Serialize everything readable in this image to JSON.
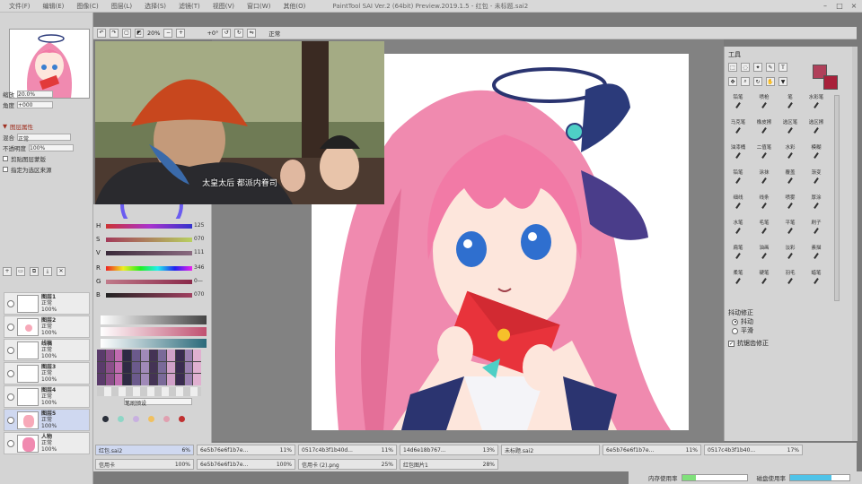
{
  "titlebar": {
    "menus": [
      "文件(F)",
      "编辑(E)",
      "图像(C)",
      "图层(L)",
      "选择(S)",
      "滤镜(T)",
      "视图(V)",
      "窗口(W)",
      "其他(O)"
    ],
    "title": "PaintTool SAI Ver.2 (64bit) Preview.2019.1.5 - 红包 - 未标题.sai2"
  },
  "toolbar": {
    "zoom": "20%",
    "angle": "+0°",
    "mode": "正常"
  },
  "navigator": {
    "zoom_label": "缩放",
    "zoom_value": "20.0%",
    "angle_label": "角度",
    "angle_value": "+000"
  },
  "layer_props": {
    "section": "图层属性",
    "blend_label": "混合",
    "blend_value": "正常",
    "opacity_label": "不透明度",
    "opacity_value": "100%",
    "clip_label": "剪贴图层蒙版",
    "ref_label": "指定为选区来源"
  },
  "layers": [
    {
      "name": "图层1",
      "mode": "正常",
      "opacity": "100%"
    },
    {
      "name": "图层2",
      "mode": "正常",
      "opacity": "100%"
    },
    {
      "name": "线稿",
      "mode": "正常",
      "opacity": "100%"
    },
    {
      "name": "图层3",
      "mode": "正常",
      "opacity": "100%"
    },
    {
      "name": "图层4",
      "mode": "正常",
      "opacity": "100%"
    },
    {
      "name": "图层5",
      "mode": "正常",
      "opacity": "100%"
    },
    {
      "name": "人物",
      "mode": "正常",
      "opacity": "100%"
    }
  ],
  "color": {
    "hsv": [
      {
        "label": "H",
        "value": "125"
      },
      {
        "label": "S",
        "value": "070"
      },
      {
        "label": "V",
        "value": "111"
      }
    ],
    "rgb": [
      {
        "label": "R",
        "value": "346"
      },
      {
        "label": "G",
        "value": "0—"
      },
      {
        "label": "B",
        "value": "070"
      }
    ],
    "swatches": [
      "#5a3b6b",
      "#8b4f8a",
      "#c06bb0",
      "#2e2a44",
      "#6b5a8c",
      "#a08ab8",
      "#443355",
      "#7a6a99",
      "#d0a0c8",
      "#3a2b50",
      "#9a7fb0",
      "#e0b0d0"
    ],
    "dots": [
      "#2a2f3a",
      "#8ed6c6",
      "#c8b0e0",
      "#f0c060",
      "#e0a0b0",
      "#c03030"
    ],
    "brush_preset_label": "笔刷预设"
  },
  "video": {
    "subtitle": "太皇太后 都派内眷司"
  },
  "right_panel": {
    "title": "工具",
    "primary_color": "#b0405a",
    "secondary_color": "#a8203a",
    "brush_rows": [
      [
        "铅笔",
        "喷枪",
        "笔",
        "水彩笔"
      ],
      [
        "马克笔",
        "橡皮擦",
        "选区笔",
        "选区擦"
      ],
      [
        "油漆桶",
        "二值笔",
        "水彩",
        "模糊"
      ],
      [
        "铅笔",
        "涂抹",
        "覆盖",
        "渐变"
      ],
      [
        "细线",
        "线条",
        "喷雾",
        "厚涂"
      ],
      [
        "水笔",
        "毛笔",
        "平笔",
        "刷子"
      ],
      [
        "扁笔",
        "油画",
        "淡彩",
        "素描"
      ],
      [
        "柔笔",
        "硬笔",
        "羽毛",
        "蜡笔"
      ]
    ],
    "stabilizer_label": "抖动修正",
    "opt1": "抖动",
    "opt2": "平滑",
    "check_label": "抗锯齿修正"
  },
  "doc_tabs": [
    [
      "红包.sai2",
      "6%"
    ],
    [
      "6e5b76e6f1b7e...",
      "11%"
    ],
    [
      "0517c4b3f1b40d...",
      "11%"
    ],
    [
      "14d6e18b767...",
      "13%"
    ],
    [
      "未标题.sai2",
      ""
    ],
    [
      "6e5b76e6f1b7e...",
      "11%"
    ],
    [
      "0517c4b3f1b40...",
      "17%"
    ],
    [
      "信用卡",
      "100%"
    ],
    [
      "6e5b76e6f1b7e...",
      "100%"
    ],
    [
      "信用卡 (2).png",
      "25%"
    ],
    [
      "红包图片1",
      "28%"
    ]
  ],
  "status": {
    "memory_label": "内存使用率",
    "memory_pct": 0.22,
    "disk_label": "磁盘使用率",
    "disk_pct": 0.7
  }
}
